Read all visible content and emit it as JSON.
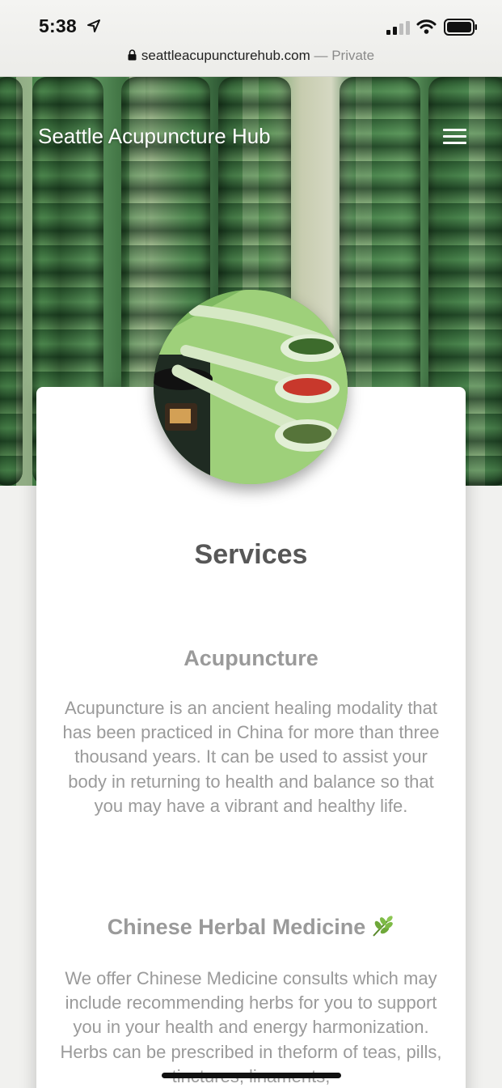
{
  "status_bar": {
    "time": "5:38",
    "url": "seattleacupuncturehub.com",
    "url_suffix": " — Private"
  },
  "header": {
    "site_title": "Seattle Acupuncture Hub",
    "menu_icon": "hamburger-menu-icon"
  },
  "main": {
    "section_title": "Services",
    "services": [
      {
        "title": "Acupuncture",
        "text": "Acupuncture is an ancient healing modality that has been practiced in China for more than three thousand years. It can be used to assist your body in returning to health and balance so that you may have a vibrant and healthy life."
      },
      {
        "title": "Chinese Herbal Medicine",
        "icon": "herb-leaf-icon",
        "text": "We offer Chinese Medicine consults which may include recommending herbs for you to support you in your health and energy harmonization. Herbs can be prescribed in theform of teas, pills, tinctures, linaments,"
      }
    ]
  },
  "colors": {
    "heading": "#575757",
    "body_text": "#9a9a9a",
    "hero_green": "#3d7040"
  }
}
